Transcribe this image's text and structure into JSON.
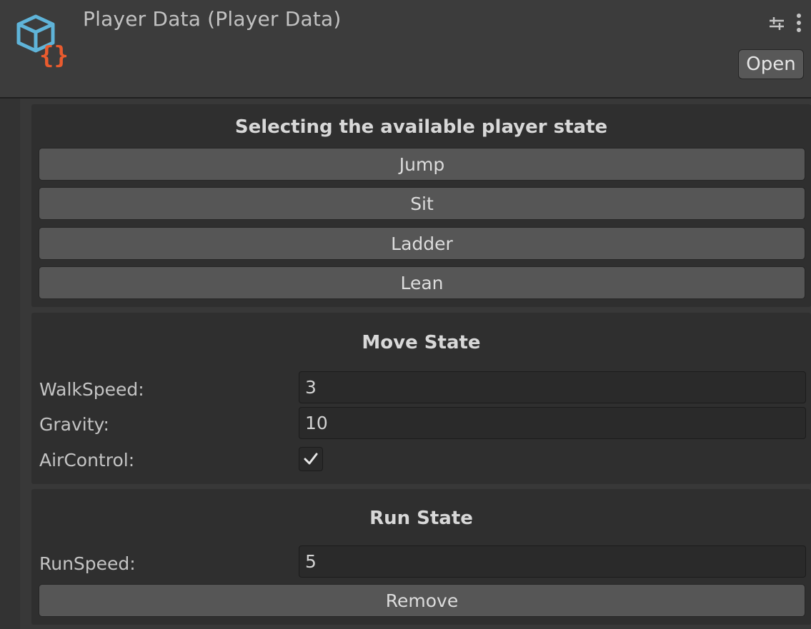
{
  "header": {
    "title": "Player Data (Player Data)",
    "open_label": "Open",
    "asset_icon": "scriptable-object-icon",
    "settings_icon": "settings-sliders-icon",
    "more_icon": "vertical-ellipsis-icon"
  },
  "states_section": {
    "title": "Selecting the available player state",
    "buttons": [
      {
        "label": "Jump"
      },
      {
        "label": "Sit"
      },
      {
        "label": "Ladder"
      },
      {
        "label": "Lean"
      }
    ]
  },
  "move_state": {
    "title": "Move State",
    "fields": {
      "walk_speed": {
        "label": "WalkSpeed:",
        "value": "3"
      },
      "gravity": {
        "label": "Gravity:",
        "value": "10"
      },
      "air_control": {
        "label": "AirControl:",
        "checked": true
      }
    }
  },
  "run_state": {
    "title": "Run State",
    "fields": {
      "run_speed": {
        "label": "RunSpeed:",
        "value": "5"
      }
    },
    "remove_label": "Remove"
  },
  "colors": {
    "background": "#383838",
    "panel": "#2f2f2f",
    "button": "#565656",
    "input": "#2a2a2a",
    "icon_blue": "#5fb4d9",
    "icon_orange": "#ea5b2e"
  }
}
